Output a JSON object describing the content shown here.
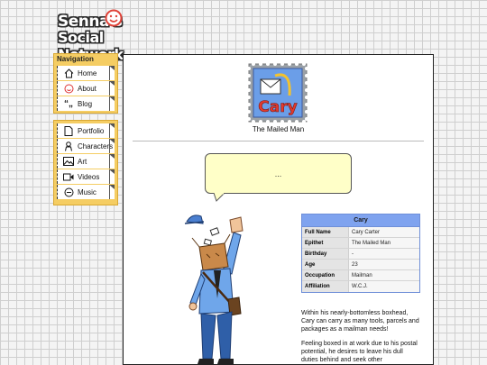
{
  "site": {
    "title_line1": "Senna's",
    "title_line2": "Social Network"
  },
  "nav": {
    "heading": "Navigation",
    "group1": [
      {
        "label": "Home",
        "icon": "home-icon"
      },
      {
        "label": "About",
        "icon": "smile-icon"
      },
      {
        "label": "Blog",
        "icon": "quote-icon"
      }
    ],
    "group2": [
      {
        "label": "Portfolio",
        "icon": "document-icon"
      },
      {
        "label": "Characters",
        "icon": "person-icon"
      },
      {
        "label": "Art",
        "icon": "image-icon"
      },
      {
        "label": "Videos",
        "icon": "video-camera-icon"
      },
      {
        "label": "Music",
        "icon": "music-icon"
      }
    ]
  },
  "character": {
    "stamp_name": "Cary",
    "caption": "The Mailed Man",
    "speech": "...",
    "info_title": "Cary",
    "info_rows": [
      {
        "key": "Full Name",
        "value": "Cary Carter"
      },
      {
        "key": "Epithet",
        "value": "The Mailed Man"
      },
      {
        "key": "Birthday",
        "value": "-"
      },
      {
        "key": "Age",
        "value": "23"
      },
      {
        "key": "Occupation",
        "value": "Mailman"
      },
      {
        "key": "Affiliation",
        "value": "W.C.J."
      }
    ],
    "description": [
      "Within his nearly-bottomless boxhead, Cary can carry as many tools, parcels and packages as a mailman needs!",
      "Feeling boxed in at work due to his postal potential, he desires to leave his dull duties behind and seek other"
    ]
  },
  "colors": {
    "nav_bg": "#f5cd63",
    "stamp_frame": "#9aa0a6",
    "stamp_name": "#e23a2e",
    "info_header": "#7fa3ef",
    "bubble": "#ffffc8"
  }
}
